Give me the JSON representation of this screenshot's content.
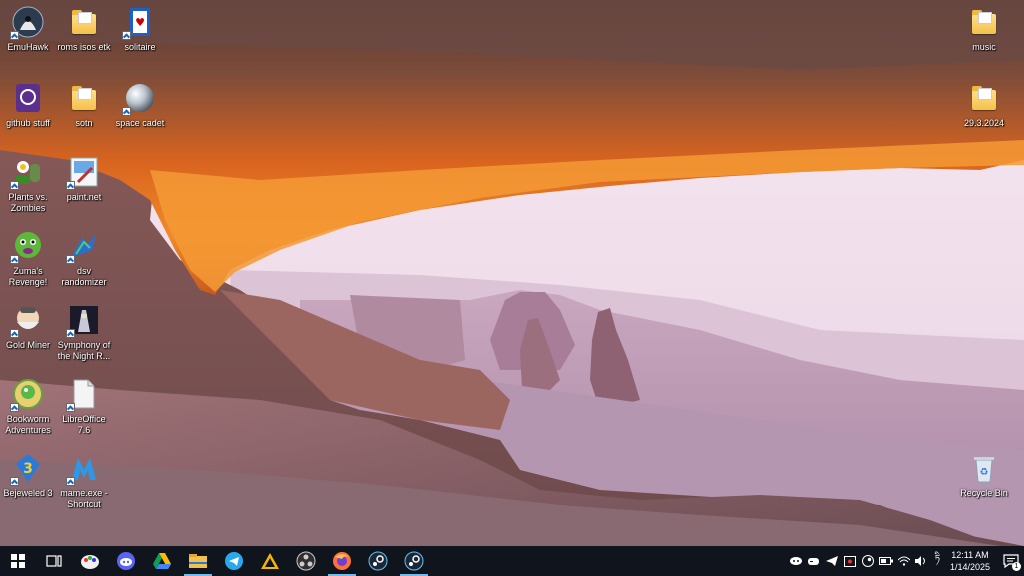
{
  "desktop": {
    "icons_left": [
      {
        "label": "EmuHawk",
        "icon": "emuhawk-icon"
      },
      {
        "label": "roms isos etk",
        "icon": "folder-icon"
      },
      {
        "label": "solitaire",
        "icon": "solitaire-icon"
      },
      {
        "label": "github stuff",
        "icon": "github-desktop-icon"
      },
      {
        "label": "sotn",
        "icon": "folder-icon"
      },
      {
        "label": "space cadet",
        "icon": "pinball-icon"
      },
      {
        "label": "Plants vs. Zombies",
        "icon": "plants-vs-zombies-icon"
      },
      {
        "label": "paint.net",
        "icon": "paint-net-icon"
      },
      {
        "label": "Zuma's Revenge!",
        "icon": "zuma-icon"
      },
      {
        "label": "dsv randomizer",
        "icon": "dsv-randomizer-icon"
      },
      {
        "label": "Gold Miner",
        "icon": "gold-miner-icon"
      },
      {
        "label": "Symphony of the Night R...",
        "icon": "sotn-randomizer-icon"
      },
      {
        "label": "Bookworm Adventures",
        "icon": "bookworm-icon"
      },
      {
        "label": "LibreOffice 7.6",
        "icon": "libreoffice-icon"
      },
      {
        "label": "Bejeweled 3",
        "icon": "bejeweled-icon"
      },
      {
        "label": "mame.exe - Shortcut",
        "icon": "mame-icon"
      }
    ],
    "icons_right": [
      {
        "label": "music",
        "icon": "folder-icon"
      },
      {
        "label": "29.3.2024",
        "icon": "folder-icon"
      },
      {
        "label": "Recycle Bin",
        "icon": "recycle-bin-icon"
      }
    ]
  },
  "taskbar": {
    "pinned": [
      {
        "name": "start",
        "icon": "windows-start-icon"
      },
      {
        "name": "task-view",
        "icon": "task-view-icon"
      },
      {
        "name": "paint",
        "icon": "paint-app-icon"
      },
      {
        "name": "discord",
        "icon": "discord-icon"
      },
      {
        "name": "google-drive",
        "icon": "google-drive-icon"
      },
      {
        "name": "file-explorer",
        "icon": "file-explorer-icon"
      },
      {
        "name": "telegram",
        "icon": "telegram-icon"
      },
      {
        "name": "arduino-ide",
        "icon": "arduino-ide-icon"
      },
      {
        "name": "obs-studio",
        "icon": "obs-icon"
      },
      {
        "name": "firefox",
        "icon": "firefox-icon"
      },
      {
        "name": "steam",
        "icon": "steam-icon"
      },
      {
        "name": "steam-2",
        "icon": "steam-icon"
      }
    ],
    "tray_icons": [
      "discord-tray-icon",
      "gamepad-tray-icon",
      "telegram-tray-icon",
      "capture-tray-icon",
      "steam-tray-icon",
      "battery-icon",
      "wifi-icon",
      "volume-icon"
    ],
    "language": "ཏི",
    "time": "12:11 AM",
    "date": "1/14/2025",
    "notification_count": "1"
  },
  "colors": {
    "taskbar_bg": "#10141c",
    "accent": "#76b9ed"
  }
}
